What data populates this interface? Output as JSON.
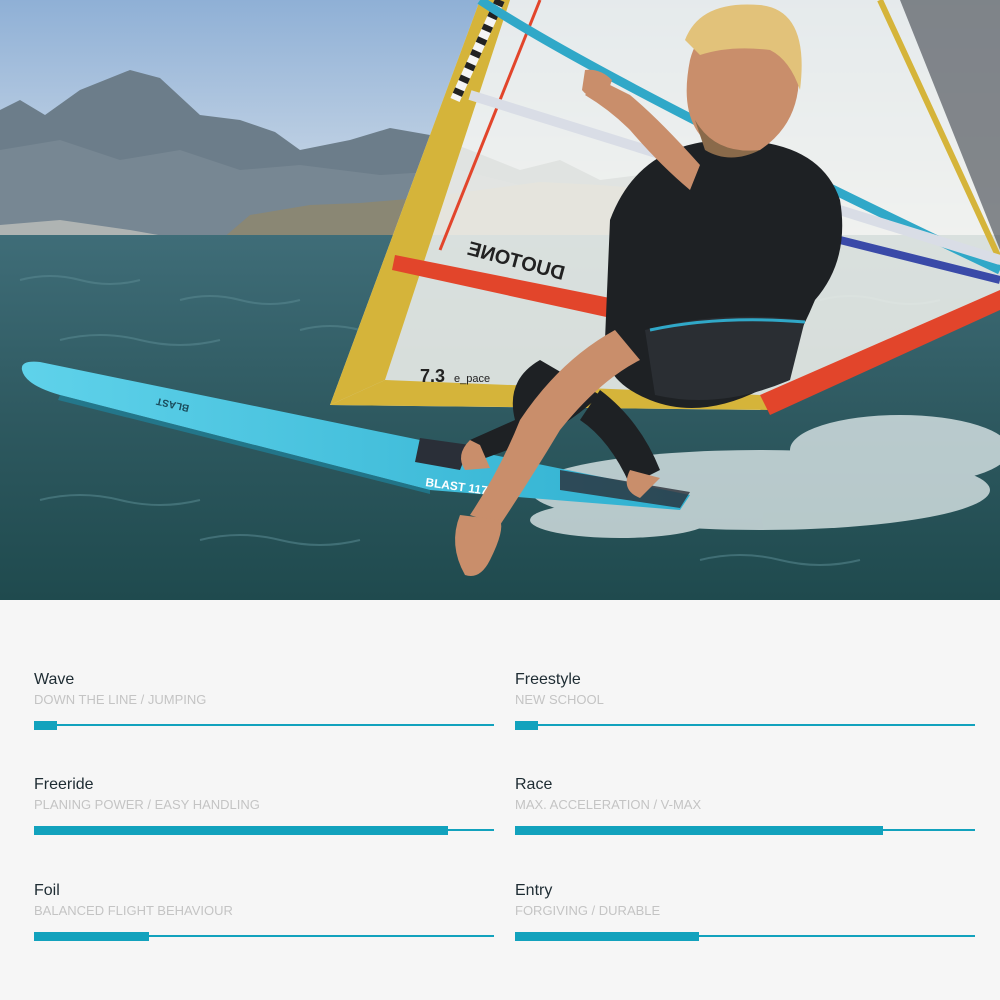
{
  "hero": {
    "board_label": "BLAST 117",
    "board_tail_label": "BLAST",
    "sail_brand": "DUOTONE",
    "sail_size": "7.3",
    "sail_model": "e_pace",
    "colors": {
      "sky": "#a9c3dc",
      "water": "#2d5a5f",
      "board": "#3dc0dc",
      "sail_yellow": "#d5b43a",
      "sail_red": "#e2452b"
    }
  },
  "ratings": [
    {
      "title": "Wave",
      "subtitle": "DOWN THE LINE / JUMPING",
      "level": 0.05
    },
    {
      "title": "Freestyle",
      "subtitle": "NEW SCHOOL",
      "level": 0.05
    },
    {
      "title": "Freeride",
      "subtitle": "PLANING POWER / EASY HANDLING",
      "level": 0.9
    },
    {
      "title": "Race",
      "subtitle": "MAX. ACCELERATION / V-MAX",
      "level": 0.8
    },
    {
      "title": "Foil",
      "subtitle": "BALANCED FLIGHT BEHAVIOUR",
      "level": 0.25
    },
    {
      "title": "Entry",
      "subtitle": "FORGIVING / DURABLE",
      "level": 0.4
    }
  ],
  "colors": {
    "accent": "#12a2bd",
    "title_text": "#1e2c33",
    "subtitle_text": "#c4c4c4",
    "panel_bg": "#f6f6f6"
  }
}
